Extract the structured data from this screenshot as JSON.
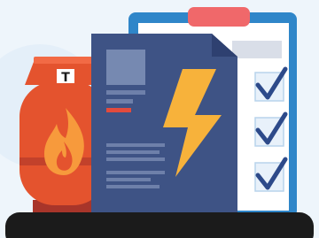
{
  "illustration": {
    "gas_cylinder": {
      "icon": "flame-icon",
      "valve_letter": "T"
    },
    "document": {
      "icon": "lightning-bolt-icon"
    },
    "checklist": {
      "checked_items": 3,
      "icon": "checkmark-icon"
    }
  },
  "colors": {
    "background": "#EEF5FB",
    "clipboard_blue": "#2F86C9",
    "clipboard_clip": "#F0686A",
    "paper": "#FFFFFF",
    "check_stroke": "#2D4A8A",
    "cylinder_red": "#E4532E",
    "cylinder_dark": "#A8352A",
    "flame_orange": "#F79A3C",
    "doc_navy": "#3E5385",
    "bolt_yellow": "#F7B23B",
    "accent_red": "#E24B3D",
    "ground_black": "#1B1B1B"
  }
}
